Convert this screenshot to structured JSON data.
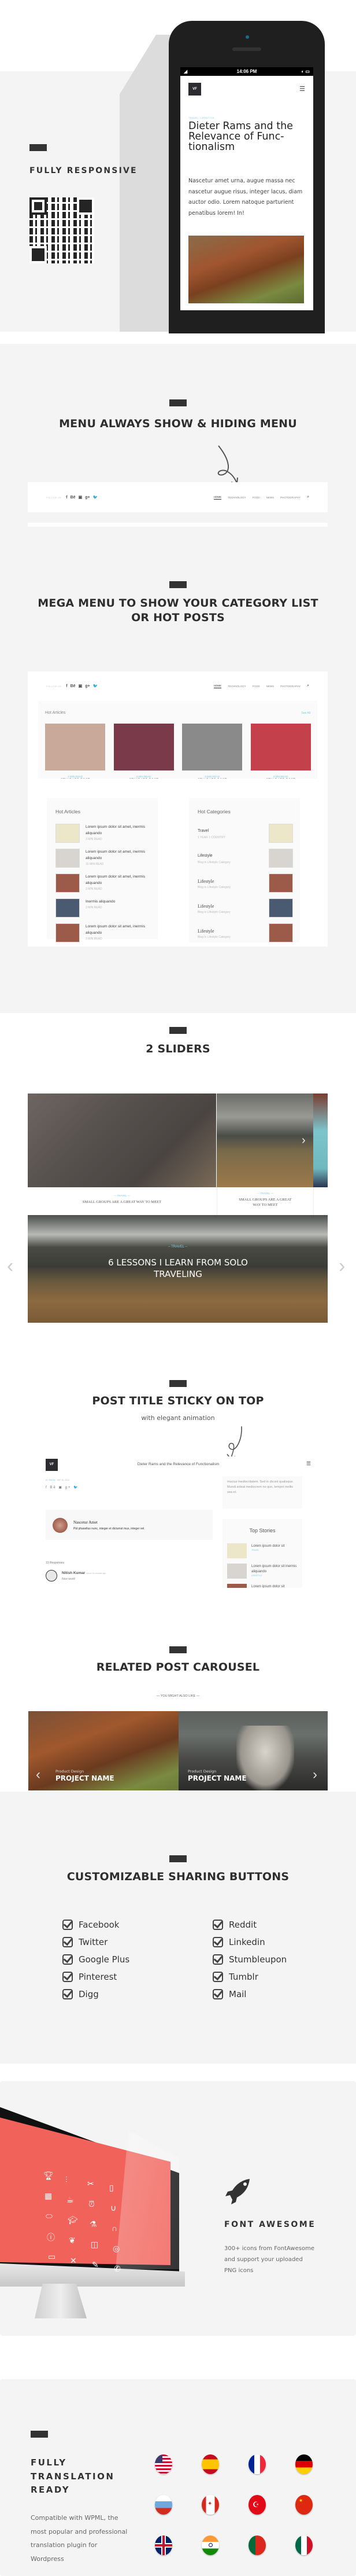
{
  "responsive": {
    "title": "FULLY RESPONSIVE",
    "phone": {
      "time": "14:06 PM",
      "logo": "VF",
      "category": "TRAVEL / LIFESTYLE",
      "post_title": "Dieter Rams and the Relevance of Functionalism",
      "post_title_lines": [
        "Dieter Rams and the",
        "Relevance of Func-",
        "tionalism"
      ],
      "excerpt": "Nascetur amet urna, augue massa nec nascetur augue risus, integer lacus, diam auctor odio. Lorem natoque parturient penatibus lorem! In!"
    }
  },
  "menu_section": {
    "title": "MENU ALWAYS SHOW & HIDING MENU",
    "follow_label": "FOLLOW US",
    "social": [
      "f",
      "Be",
      "You",
      "g+",
      "t"
    ],
    "menu_items": [
      "HOME",
      "TECHNOLOGY",
      "FOOD",
      "NEWS",
      "PHOTOGRAPHY"
    ],
    "active_item": "HOME"
  },
  "mega_menu": {
    "title_line1": "MEGA MENU TO SHOW YOUR CATEGORY LIST",
    "title_line2": "OR HOT POSTS",
    "hot_articles_label": "Hot Articles",
    "see_all": "See All",
    "grid_posts": [
      {
        "meta": "3 MIN READ",
        "title": "STANDARD POST",
        "color": "#c9a99a"
      },
      {
        "meta": "3 MIN READ",
        "title": "STANDARD POST",
        "color": "#7a3a4a"
      },
      {
        "meta": "3 MIN READ",
        "title": "STANDARD POST",
        "color": "#8a8a8a"
      },
      {
        "meta": "3 MIN READ",
        "title": "STANDARD POST",
        "color": "#c4404a"
      }
    ],
    "hot_articles": {
      "heading": "Hot Articles",
      "items": [
        {
          "title": "Lorem ipsum dolor sit amet, inermis aliquando",
          "meta": "3 MIN READ",
          "color": "#ece7c8"
        },
        {
          "title": "Lorem ipsum dolor sit amet, inermis aliquando",
          "meta": "15 MIN READ",
          "color": "#d8d4d0"
        },
        {
          "title": "Lorem ipsum dolor sit amet, inermis aliquando",
          "meta": "3 MIN READ",
          "color": "#9c5a48"
        },
        {
          "title": "Inermis aliquando",
          "meta": "3 MIN READ",
          "color": "#4a5a70"
        },
        {
          "title": "Lorem ipsum dolor sit amet, inermis aliquando",
          "meta": "3 MIN READ",
          "color": "#9c5a48"
        }
      ]
    },
    "hot_categories": {
      "heading": "Hot Categories",
      "items": [
        {
          "name": "Travel",
          "sub": "1 YEAR 1 COUNTRY",
          "color": "#ece7c8"
        },
        {
          "name": "Lifestyle",
          "sub": "Blog in Lifestyle Category",
          "color": "#d8d4d0"
        },
        {
          "name": "Lifestyle",
          "sub": "Blog in Lifestyle Category",
          "color": "#9c5a48"
        },
        {
          "name": "Lifestyle",
          "sub": "Blog in Lifestyle Category",
          "color": "#4a5a70"
        },
        {
          "name": "Lifestyle",
          "sub": "Blog in Lifestyle Category",
          "color": "#9c5a48"
        }
      ]
    }
  },
  "sliders": {
    "title": "2 SLIDERS",
    "slider1": [
      {
        "category": "TRAVEL",
        "title": "SMALL GROUPS ARE A GREAT WAY TO MEET"
      },
      {
        "category": "TRAVEL",
        "title": "SMALL GROUPS ARE A GREAT WAY TO MEET"
      }
    ],
    "slider2": {
      "category": "TRAVEL",
      "title": "6 LESSONS I LEARN FROM SOLO TRAVELING"
    }
  },
  "sticky": {
    "title": "POST TITLE STICKY ON TOP",
    "subtitle": "with elegant animation",
    "logo": "VF",
    "post_title": "Dieter Rams and the Relevance of Functionalism",
    "by_label": "BY",
    "author": "RWSM",
    "date": "SEP 30, 2014",
    "sidebar_text": "mucius mediocritatem. Sed in dicunt qualisque. Mundi soleat mediocrem no quo, tempor mollis sea et.",
    "author_box": {
      "name": "Nascetur Amet",
      "bio": "Pid phasellus nunc, integer et dictumst mus, integer vel."
    },
    "responses": "13 Responses",
    "comment": {
      "name": "Nitish Kumar",
      "time": "About 15 minutes ago",
      "text": "Nice work!"
    },
    "top_stories": {
      "heading": "Top Stories",
      "items": [
        {
          "title": "Lorem ipsum dolor sit",
          "cat": "TRAVEL",
          "color": "#ece7c8"
        },
        {
          "title": "Lorem ipsum dolor sit inermis aliquando",
          "cat": "LIFESTYLE",
          "color": "#d8d4d0"
        },
        {
          "title": "Lorem ipsum dolor sit",
          "cat": "TRAVEL",
          "color": "#9c5a48"
        }
      ]
    }
  },
  "related": {
    "title": "RELATED POST CAROUSEL",
    "subtitle": "YOU MIGHT ALSO LIKE",
    "items": [
      {
        "category": "Product Design",
        "name": "PROJECT NAME"
      },
      {
        "category": "Product Design",
        "name": "PROJECT NAME"
      }
    ]
  },
  "sharing": {
    "title": "CUSTOMIZABLE SHARING BUTTONS",
    "col1": [
      "Facebook",
      "Twitter",
      "Google Plus",
      "Pinterest",
      "Digg"
    ],
    "col2": [
      "Reddit",
      "Linkedin",
      "Stumbleupon",
      "Tumblr",
      "Mail"
    ]
  },
  "fontawesome": {
    "title": "FONT AWESOME",
    "description": "300+ icons from FontAwesome and support your uploaded PNG icons",
    "screen_color": "#f1625a",
    "icons": [
      "trophy",
      "sliders",
      "scissors",
      "tablet",
      "calculator",
      "coffee",
      "alarm-clock",
      "magnet",
      "pill",
      "graduation-cap",
      "flask",
      "headphones",
      "alert",
      "leaf",
      "toilet-paper",
      "target",
      "cassette",
      "cutlery",
      "brush",
      "phone"
    ]
  },
  "translation": {
    "title_lines": [
      "FULLY",
      "TRANSLATION",
      "READY"
    ],
    "description": "Compatible with WPML, the most popular and professional translation plugin for Wordpress",
    "flags": [
      "United States",
      "Spain",
      "France",
      "Germany",
      "Russia",
      "Canada",
      "Turkey",
      "China",
      "United Kingdom",
      "India",
      "Portugal",
      "Mexico"
    ]
  }
}
